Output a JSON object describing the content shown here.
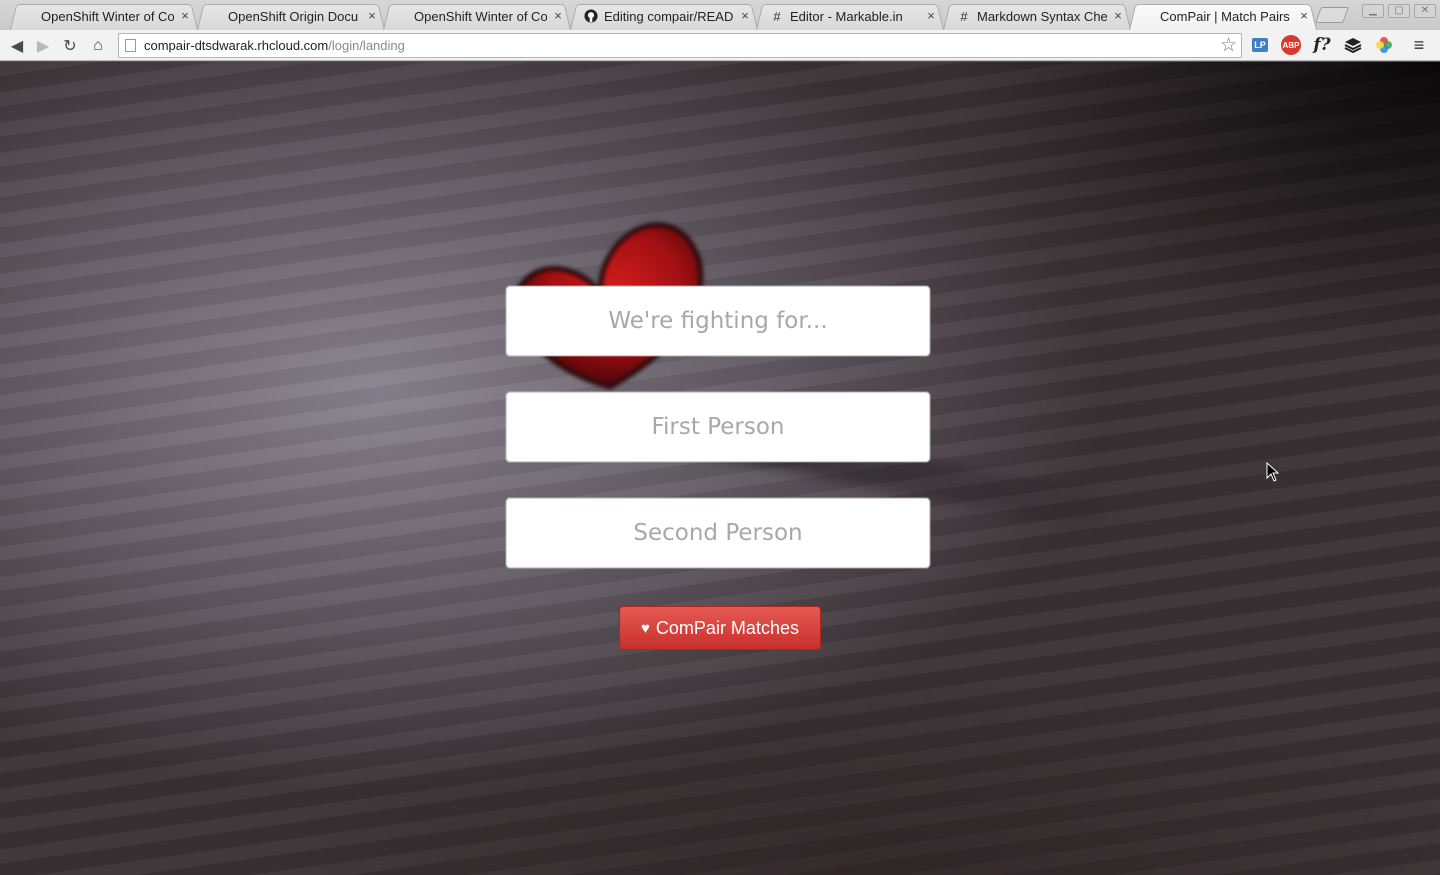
{
  "browser": {
    "tabs": [
      {
        "title": "OpenShift Winter of Co",
        "icon": "page-icon",
        "active": false
      },
      {
        "title": "OpenShift Origin Docu",
        "icon": "page-icon",
        "active": false
      },
      {
        "title": "OpenShift Winter of Co",
        "icon": "page-icon",
        "active": false
      },
      {
        "title": "Editing compair/READ",
        "icon": "github-icon",
        "active": false
      },
      {
        "title": "Editor - Markable.in",
        "icon": "hash-icon",
        "active": false
      },
      {
        "title": "Markdown Syntax Che",
        "icon": "hash-icon",
        "active": false
      },
      {
        "title": "ComPair | Match Pairs",
        "icon": "page-icon",
        "active": true
      }
    ],
    "close_glyph": "×",
    "address": {
      "host": "compair-dtsdwarak.rhcloud.com",
      "path": "/login/landing"
    },
    "extensions": [
      {
        "name": "lastpass-icon",
        "label": "LP",
        "color": "#3d7fc1"
      },
      {
        "name": "adblock-plus-icon",
        "label": "ABP",
        "color": "#d9392c"
      },
      {
        "name": "whatfont-icon",
        "label": "f?",
        "color": "#222222"
      },
      {
        "name": "buffer-icon",
        "label": "≡",
        "color": "#222222"
      },
      {
        "name": "colorpicker-icon",
        "label": "●",
        "color": "#e04040"
      },
      {
        "name": "chrome-menu-icon",
        "label": "≡",
        "color": "#333333"
      }
    ]
  },
  "form": {
    "cause_placeholder": "We're fighting for...",
    "first_person_placeholder": "First Person",
    "second_person_placeholder": "Second Person",
    "submit_label": "ComPair Matches",
    "submit_icon": "♥"
  },
  "colors": {
    "accent": "#d9534f"
  }
}
